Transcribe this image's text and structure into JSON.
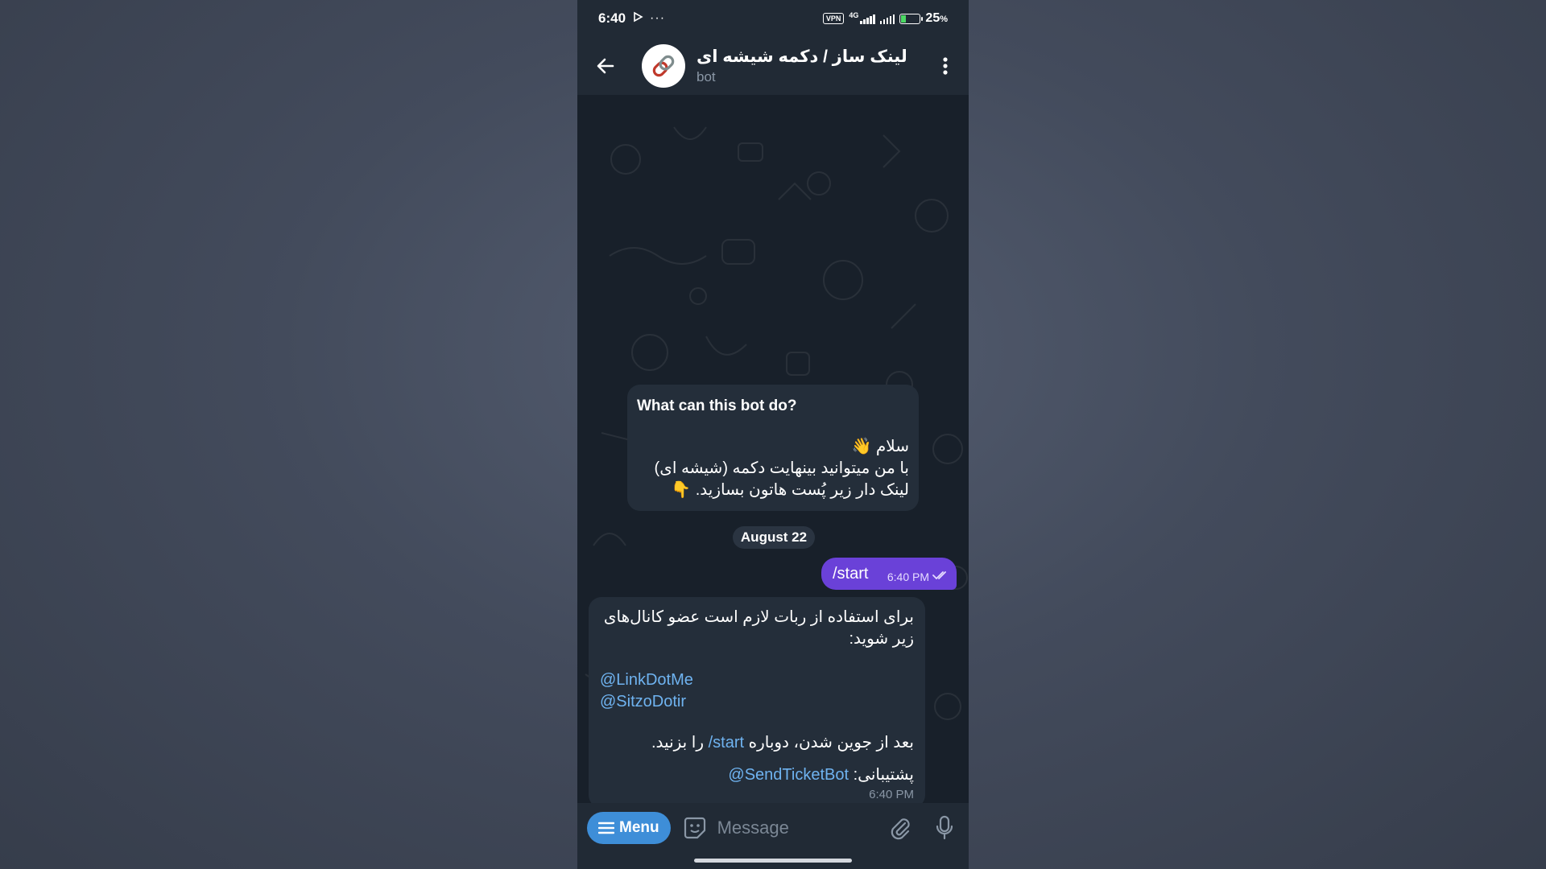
{
  "status_bar": {
    "time": "6:40",
    "vpn_label": "VPN",
    "network_label": "4G",
    "battery_percent": "25",
    "battery_unit": "%",
    "battery_level": 0.25
  },
  "header": {
    "title": "لینک ساز / دکمه شیشه ای",
    "subtitle": "bot"
  },
  "intro_card": {
    "title": "What can this bot do?",
    "body": "سلام 👋\nبا من میتوانید بینهایت دکمه (شیشه ای)\nلینک دار زیر پُست هاتون بسازید. 👇"
  },
  "date_separator": "August 22",
  "outgoing_message": {
    "text": "/start",
    "time": "6:40 PM"
  },
  "incoming_message": {
    "line1": "برای استفاده از ربات لازم است عضو کانال‌های زیر شوید:",
    "links": [
      "@LinkDotMe",
      "@SitzoDotir"
    ],
    "line2_prefix": "بعد از جوین شدن، دوباره ",
    "line2_command": "/start",
    "line2_suffix": " را بزنید.",
    "support_label": "پشتیبانی: ",
    "support_link": "@SendTicketBot",
    "time": "6:40 PM"
  },
  "composer": {
    "menu_label": "Menu",
    "placeholder": "Message"
  },
  "colors": {
    "accent_menu": "#3e8ed8",
    "outgoing_bubble": "#6a41d8",
    "link": "#6fb3f0"
  },
  "icons": [
    "back-arrow-icon",
    "more-vert-icon",
    "link-icon",
    "hamburger-icon",
    "sticker-icon",
    "paperclip-icon",
    "microphone-icon",
    "double-check-icon",
    "play-icon"
  ]
}
